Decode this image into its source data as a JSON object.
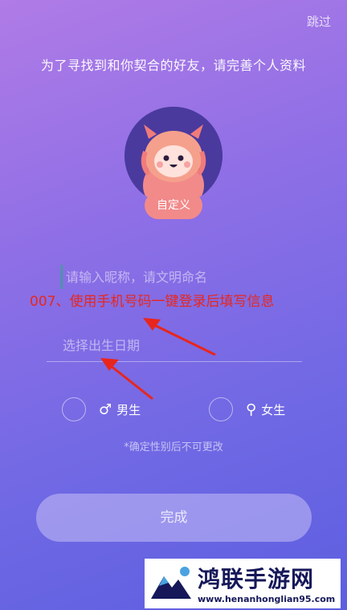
{
  "header": {
    "skip_label": "跳过"
  },
  "tagline": "为了寻找到和你契合的好友，请完善个人资料",
  "avatar": {
    "custom_label": "自定义"
  },
  "form": {
    "nickname_placeholder": "请输入昵称，请文明命名",
    "birth_placeholder": "选择出生日期",
    "male_label": "男生",
    "male_symbol": "♂",
    "female_label": "女生",
    "female_symbol": "⚲",
    "note": "*确定性别后不可更改",
    "submit_label": "完成"
  },
  "overlay": {
    "annotation": "007、使用手机号码一键登录后填写信息",
    "annotation_color": "#e8261d",
    "brand_name": "鸿联手游网",
    "brand_url": "www.henanhonglian95.com",
    "brand_color": "#16185a"
  },
  "colors": {
    "gradient_top": "#b07be6",
    "gradient_bottom": "#5d5fe0",
    "button_pink": "#f28a8a"
  }
}
